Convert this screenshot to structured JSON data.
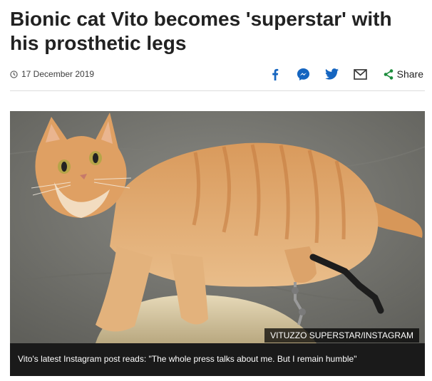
{
  "article": {
    "headline": "Bionic cat Vito becomes 'superstar' with his prosthetic legs",
    "date": "17 December 2019"
  },
  "share": {
    "label": "Share",
    "icons": [
      "facebook-icon",
      "messenger-icon",
      "twitter-icon",
      "email-icon",
      "share-icon"
    ]
  },
  "figure": {
    "credit": "VITUZZO SUPERSTAR/INSTAGRAM",
    "caption": "Vito's latest Instagram post reads: \"The whole press talks about me. But I remain humble\""
  },
  "colors": {
    "text": "#222222",
    "icon_blue": "#1565c0",
    "caption_bg": "#1a1a1a"
  }
}
